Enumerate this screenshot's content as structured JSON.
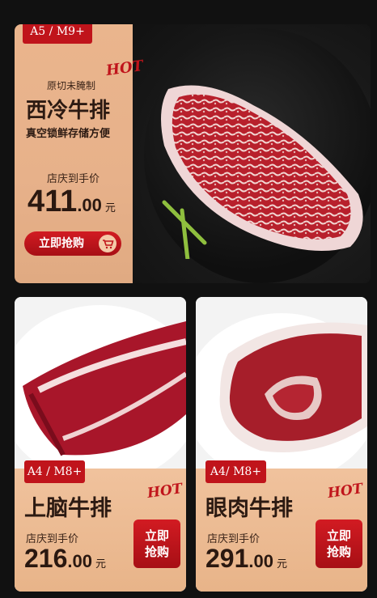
{
  "hero": {
    "grade": "A5 / M9+",
    "hot": "HOT",
    "tagline": "原切未腌制",
    "name": "西冷牛排",
    "feature": "真空锁鲜存储方便",
    "price_label": "店庆到手价",
    "price_int": "411",
    "price_dec": ".00",
    "currency": "元",
    "buy_label": "立即抢购",
    "cart_icon": "cart-icon"
  },
  "left_card": {
    "grade": "A4 / M8+",
    "hot": "HOT",
    "name": "上脑牛排",
    "price_label": "店庆到手价",
    "price_int": "216",
    "price_dec": ".00",
    "currency": "元",
    "buy_label_1": "立即",
    "buy_label_2": "抢购"
  },
  "right_card": {
    "grade": "A4/ M8+",
    "hot": "HOT",
    "name": "眼肉牛排",
    "price_label": "店庆到手价",
    "price_int": "291",
    "price_dec": ".00",
    "currency": "元",
    "buy_label_1": "立即",
    "buy_label_2": "抢购"
  },
  "colors": {
    "accent": "#c0141b",
    "panel": "#e9b48b",
    "text": "#2c1a12"
  }
}
